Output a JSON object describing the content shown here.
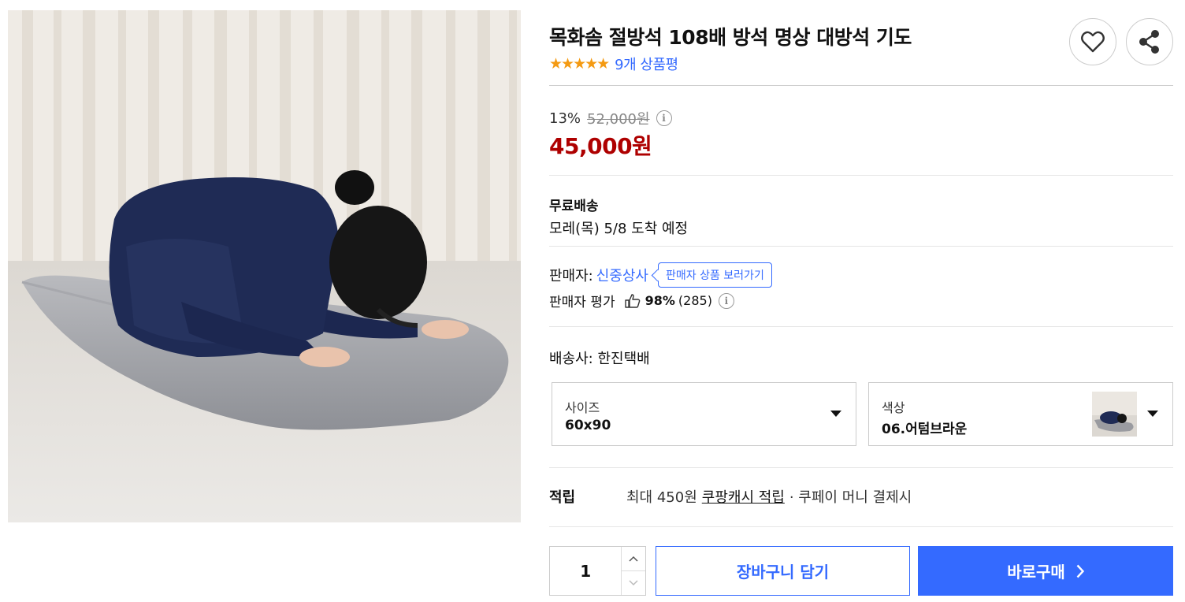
{
  "product": {
    "title": "목화솜 절방석 108배 방석 명상 대방석 기도",
    "stars": "★★★★★",
    "review_count": "9개 상품평",
    "rating_fraction": 1.0
  },
  "price": {
    "discount_rate": "13%",
    "original_price": "52,000원",
    "sale_price": "45,000원",
    "info_glyph": "i"
  },
  "shipping": {
    "title": "무료배송",
    "arrival": "모레(목) 5/8 도착 예정"
  },
  "seller": {
    "label": "판매자:",
    "name": "신중상사",
    "tooltip": "판매자 상품 보러가기",
    "rating_label": "판매자 평가",
    "rating_percent": "98%",
    "rating_count": "(285)"
  },
  "courier": {
    "text": "배송사: 한진택배"
  },
  "options": {
    "size": {
      "label": "사이즈",
      "value": "60x90"
    },
    "color": {
      "label": "색상",
      "value": "06.어텀브라운"
    }
  },
  "reward": {
    "title": "적립",
    "prefix": "최대 450원",
    "link": "쿠팡캐시 적립",
    "suffix": "· 쿠페이 머니 결제시"
  },
  "purchase": {
    "quantity": "1",
    "cart_label": "장바구니 담기",
    "buy_label": "바로구매"
  },
  "colors": {
    "accent": "#346aff",
    "price_red": "#ae0000",
    "star": "#f49a12"
  },
  "icons": {
    "wish": "heart-icon",
    "share": "share-icon",
    "info": "info-icon",
    "thumb": "thumbs-up-icon",
    "caret": "caret-down-icon",
    "chevron": "chevron-right-icon"
  }
}
